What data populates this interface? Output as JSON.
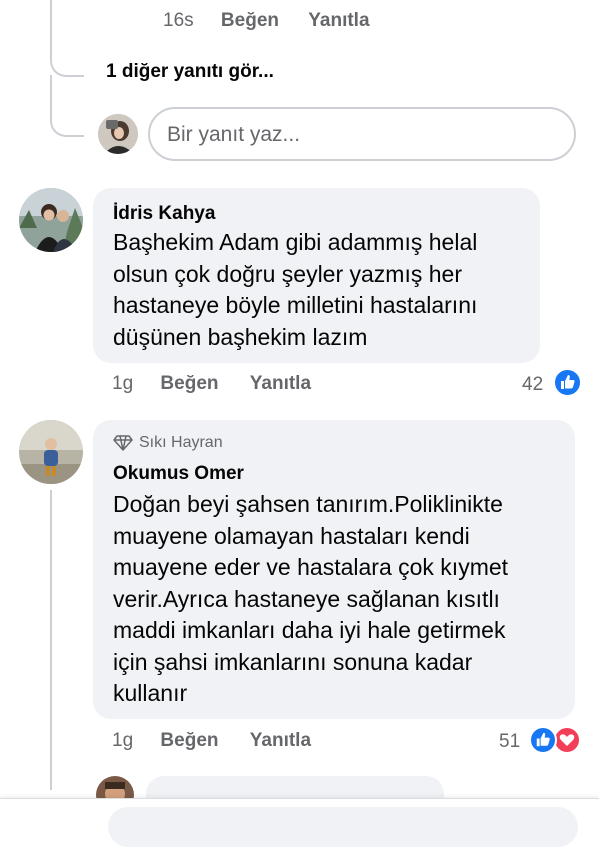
{
  "top_reply": {
    "time": "16s",
    "like": "Beğen",
    "reply": "Yanıtla"
  },
  "more_replies": "1 diğer yanıtı gör...",
  "reply_input": {
    "placeholder": "Bir yanıt yaz..."
  },
  "comments": [
    {
      "author": "İdris Kahya",
      "lines": [
        "Başhekim Adam gibi adammış helal",
        "olsun çok doğru şeyler yazmış her",
        "hastaneye böyle milletini hastalarını",
        "düşünen başhekim lazım"
      ],
      "time": "1g",
      "like": "Beğen",
      "reply": "Yanıtla",
      "reaction_count": "42",
      "reactions": [
        "like-icon"
      ]
    },
    {
      "badge": "Sıkı Hayran",
      "author": "Okumus Omer",
      "lines": [
        "Doğan beyi şahsen tanırım.Poliklinikte",
        "muayene olamayan hastaları kendi",
        "muayene eder ve hastalara çok kıymet",
        "verir.Ayrıca hastaneye sağlanan kısıtlı",
        "maddi imkanları daha iyi hale getirmek",
        "için şahsi imkanlarını sonuna kadar",
        "kullanır"
      ],
      "time": "1g",
      "like": "Beğen",
      "reply": "Yanıtla",
      "reaction_count": "51",
      "reactions": [
        "like-icon",
        "love-icon"
      ]
    }
  ],
  "colors": {
    "bubble": "#f0f2f5",
    "meta": "#65676b",
    "like": "#1877f2",
    "love": "#f33e58"
  }
}
